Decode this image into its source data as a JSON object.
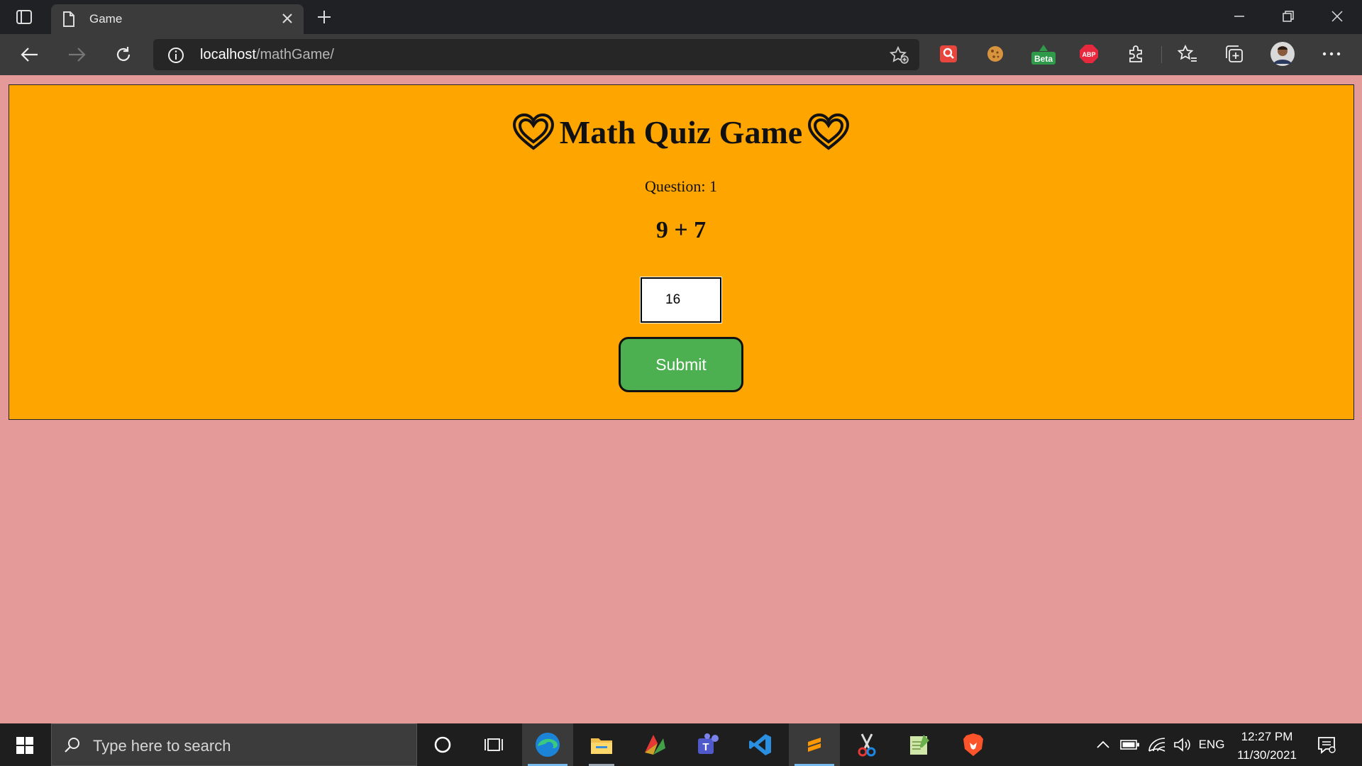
{
  "browser": {
    "tab_title": "Game",
    "url_host": "localhost",
    "url_path": "/mathGame/",
    "extensions": [
      "search-extension",
      "cookie-extension",
      "beta-extension",
      "adblock-plus",
      "extensions-puzzle",
      "favorites",
      "collections",
      "profile"
    ],
    "beta_badge": "Beta",
    "abp_label": "ABP"
  },
  "game": {
    "title": "Math Quiz Game",
    "question_label": "Question: 1",
    "problem": "9 + 7",
    "answer_value": "16",
    "submit_label": "Submit"
  },
  "taskbar": {
    "search_placeholder": "Type here to search",
    "language": "ENG",
    "time": "12:27 PM",
    "date": "11/30/2021"
  },
  "colors": {
    "page_background": "#e59a9a",
    "game_box": "#ffa500",
    "submit_button": "#4caf50"
  }
}
